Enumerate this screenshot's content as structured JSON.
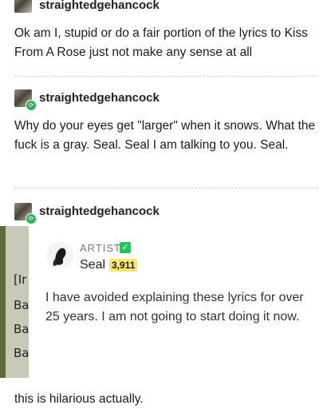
{
  "posts": [
    {
      "username": "straightedgehancock",
      "text": "Ok am I, stupid or do a fair portion of the lyrics to Kiss From A Rose just not make any sense at all"
    },
    {
      "username": "straightedgehancock",
      "text": "Why do your eyes get \"larger\" when it snows. What the fuck is a gray. Seal. Seal I am talking to you. Seal."
    },
    {
      "username": "straightedgehancock"
    }
  ],
  "screenshot": {
    "left_strip_text": [
      "[Ir",
      "Ba",
      "Ba",
      "Ba"
    ],
    "badge_label": "ARTIST",
    "badge_icon": "check-icon",
    "artist_name": "Seal",
    "artist_count": "3,911",
    "reply_text": "I have avoided explaining these lyrics for over 25 years. I am not going to start doing it now."
  },
  "footer": {
    "text": "this is hilarious actually."
  },
  "colors": {
    "reblog_badge": "#2fb157",
    "verified_check": "#22c55e",
    "count_highlight": "#f7e86b"
  }
}
